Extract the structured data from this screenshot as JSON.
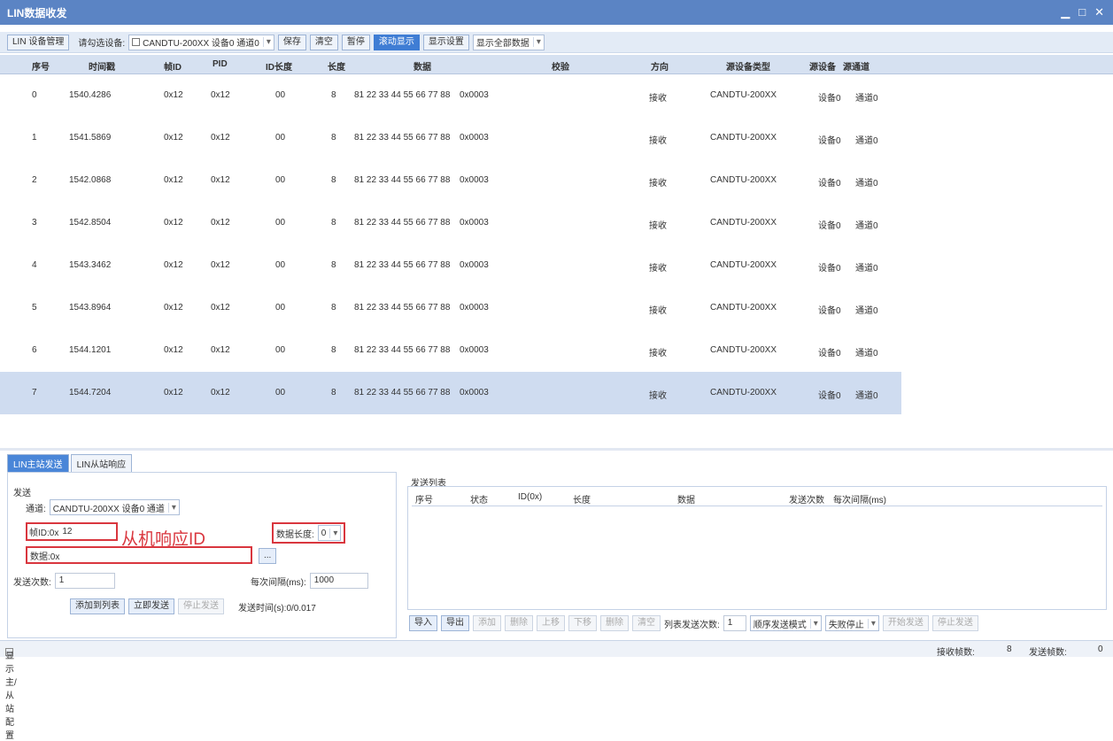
{
  "window": {
    "title": "LIN数据收发",
    "min": "▁",
    "max": "□",
    "close": "✕"
  },
  "toolbar": {
    "device_mgmt": "LIN 设备管理",
    "select_label": "请勾选设备:",
    "device_combo": "CANDTU-200XX 设备0 通道0",
    "save": "保存",
    "clear": "清空",
    "pause": "暂停",
    "scroll": "滚动显示",
    "display_settings": "显示设置",
    "show_all": "显示全部数据"
  },
  "columns": [
    "序号",
    "时间戳",
    "帧ID",
    "PID",
    "ID长度",
    "长度",
    "数据",
    "校验",
    "方向",
    "源设备类型",
    "源设备",
    "源通道"
  ],
  "rows": [
    [
      "0",
      "1540.4286",
      "0x12",
      "0x12",
      "00",
      "8",
      "81 22 33 44 55 66 77 88",
      "0x0003",
      "接收",
      "CANDTU-200XX",
      "设备0",
      "通道0"
    ],
    [
      "1",
      "1541.5869",
      "0x12",
      "0x12",
      "00",
      "8",
      "81 22 33 44 55 66 77 88",
      "0x0003",
      "接收",
      "CANDTU-200XX",
      "设备0",
      "通道0"
    ],
    [
      "2",
      "1542.0868",
      "0x12",
      "0x12",
      "00",
      "8",
      "81 22 33 44 55 66 77 88",
      "0x0003",
      "接收",
      "CANDTU-200XX",
      "设备0",
      "通道0"
    ],
    [
      "3",
      "1542.8504",
      "0x12",
      "0x12",
      "00",
      "8",
      "81 22 33 44 55 66 77 88",
      "0x0003",
      "接收",
      "CANDTU-200XX",
      "设备0",
      "通道0"
    ],
    [
      "4",
      "1543.3462",
      "0x12",
      "0x12",
      "00",
      "8",
      "81 22 33 44 55 66 77 88",
      "0x0003",
      "接收",
      "CANDTU-200XX",
      "设备0",
      "通道0"
    ],
    [
      "5",
      "1543.8964",
      "0x12",
      "0x12",
      "00",
      "8",
      "81 22 33 44 55 66 77 88",
      "0x0003",
      "接收",
      "CANDTU-200XX",
      "设备0",
      "通道0"
    ],
    [
      "6",
      "1544.1201",
      "0x12",
      "0x12",
      "00",
      "8",
      "81 22 33 44 55 66 77 88",
      "0x0003",
      "接收",
      "CANDTU-200XX",
      "设备0",
      "通道0"
    ],
    [
      "7",
      "1544.7204",
      "0x12",
      "0x12",
      "00",
      "8",
      "81 22 33 44 55 66 77 88",
      "0x0003",
      "接收",
      "CANDTU-200XX",
      "设备0",
      "通道0"
    ]
  ],
  "tabs": [
    "LIN主站发送",
    "LIN从站响应"
  ],
  "left": {
    "group": "发送",
    "channel_label": "通道:",
    "channel_value": "CANDTU-200XX 设备0 通道",
    "frameid_label": "帧ID:0x",
    "frameid_value": "12",
    "annotation": "从机响应ID",
    "datalen_label": "数据长度:",
    "datalen_value": "0",
    "data_label": "数据:0x",
    "data_value": "",
    "more": "...",
    "count_label": "发送次数:",
    "count_value": "1",
    "interval_label": "每次间隔(ms):",
    "interval_value": "1000",
    "add_list": "添加到列表",
    "send_now": "立即发送",
    "stop_send": "停止发送",
    "time_label": "发送时间(s):0/0.017"
  },
  "right": {
    "group": "发送列表",
    "headers": [
      "序号",
      "状态",
      "ID(0x)",
      "长度",
      "数据",
      "发送次数",
      "每次间隔(ms)"
    ],
    "import": "导入",
    "export": "导出",
    "add": "添加",
    "delete": "删除",
    "up": "上移",
    "down": "下移",
    "clear": "删除",
    "empty": "清空",
    "list_count_label": "列表发送次数:",
    "list_count_value": "1",
    "mode": "顺序发送模式",
    "stop_mode": "失败停止",
    "start": "开始发送",
    "stop": "停止发送"
  },
  "status": {
    "checkbox": "显示主/从站配置",
    "recv_label": "接收帧数:",
    "recv_value": "8",
    "send_label": "发送帧数:",
    "send_value": "0"
  }
}
